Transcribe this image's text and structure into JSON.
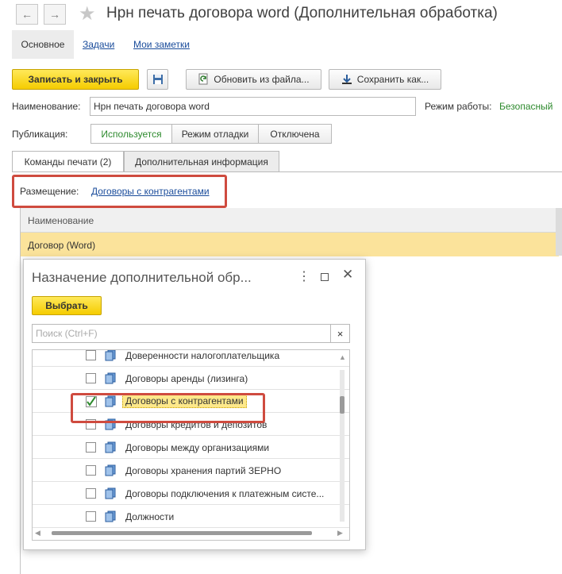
{
  "window": {
    "title": "Нрн печать договора word (Дополнительная обработка)"
  },
  "tabs": [
    {
      "label": "Основное"
    },
    {
      "label": "Задачи"
    },
    {
      "label": "Мои заметки"
    }
  ],
  "toolbar": {
    "save_close": "Записать и закрыть",
    "update_from_file": "Обновить из файла...",
    "save_as": "Сохранить как..."
  },
  "form": {
    "name_label": "Наименование:",
    "name_value": "Нрн печать договора word",
    "mode_label": "Режим работы:",
    "mode_value": "Безопасный",
    "publication_label": "Публикация:",
    "publication_options": [
      "Используется",
      "Режим отладки",
      "Отключена"
    ]
  },
  "panel_tabs": [
    "Команды печати (2)",
    "Дополнительная информация"
  ],
  "placement": {
    "label": "Размещение:",
    "link": "Договоры с контрагентами"
  },
  "commands_table": {
    "header": "Наименование",
    "rows": [
      "Договор (Word)"
    ]
  },
  "dialog": {
    "title": "Назначение дополнительной обр...",
    "select_button": "Выбрать",
    "search_placeholder": "Поиск (Ctrl+F)",
    "search_clear": "×",
    "items": [
      {
        "label": "Доверенности налогоплательщика",
        "checked": false
      },
      {
        "label": "Договоры аренды (лизинга)",
        "checked": false
      },
      {
        "label": "Договоры с контрагентами",
        "checked": true
      },
      {
        "label": "Договоры кредитов и депозитов",
        "checked": false
      },
      {
        "label": "Договоры между организациями",
        "checked": false
      },
      {
        "label": "Договоры хранения партий ЗЕРНО",
        "checked": false
      },
      {
        "label": "Договоры подключения к платежным систе...",
        "checked": false
      },
      {
        "label": "Должности",
        "checked": false
      }
    ]
  },
  "colors": {
    "accent_yellow": "#f5cc00",
    "highlight_row": "#fbe39b",
    "link_blue": "#1a4c9b",
    "annotation_red": "#cf4b3f",
    "active_green": "#2d8a2d"
  }
}
